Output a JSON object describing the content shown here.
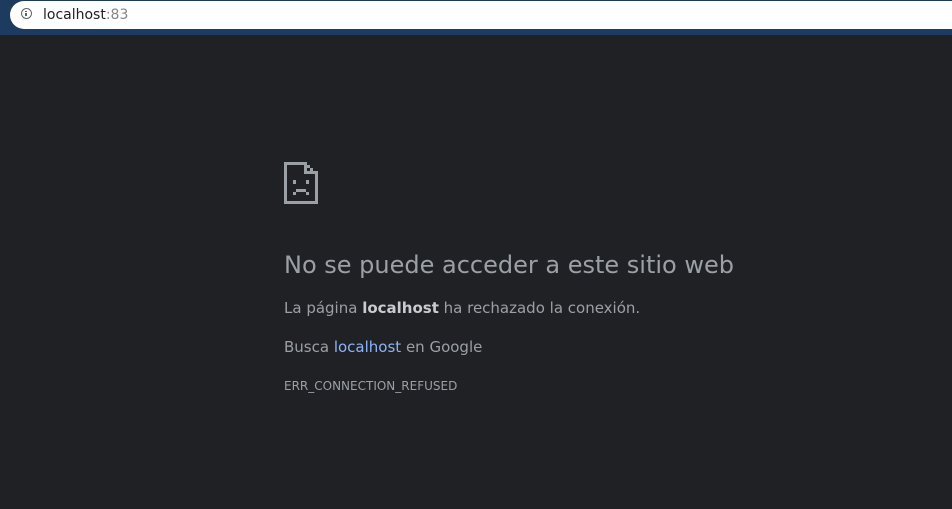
{
  "address_bar": {
    "host": "localhost",
    "port": ":83"
  },
  "error_page": {
    "icon": "sad-document-icon",
    "heading": "No se puede acceder a este sitio web",
    "refused_prefix": "La página ",
    "refused_host": "localhost",
    "refused_suffix": " ha rechazado la conexión.",
    "search_prefix": "Busca ",
    "search_link": "localhost",
    "search_suffix": " en Google",
    "error_code": "ERR_CONNECTION_REFUSED"
  },
  "colors": {
    "background": "#202124",
    "text": "#9aa0a6",
    "link": "#8ab4f8",
    "topbar": "#1d3a5f"
  }
}
